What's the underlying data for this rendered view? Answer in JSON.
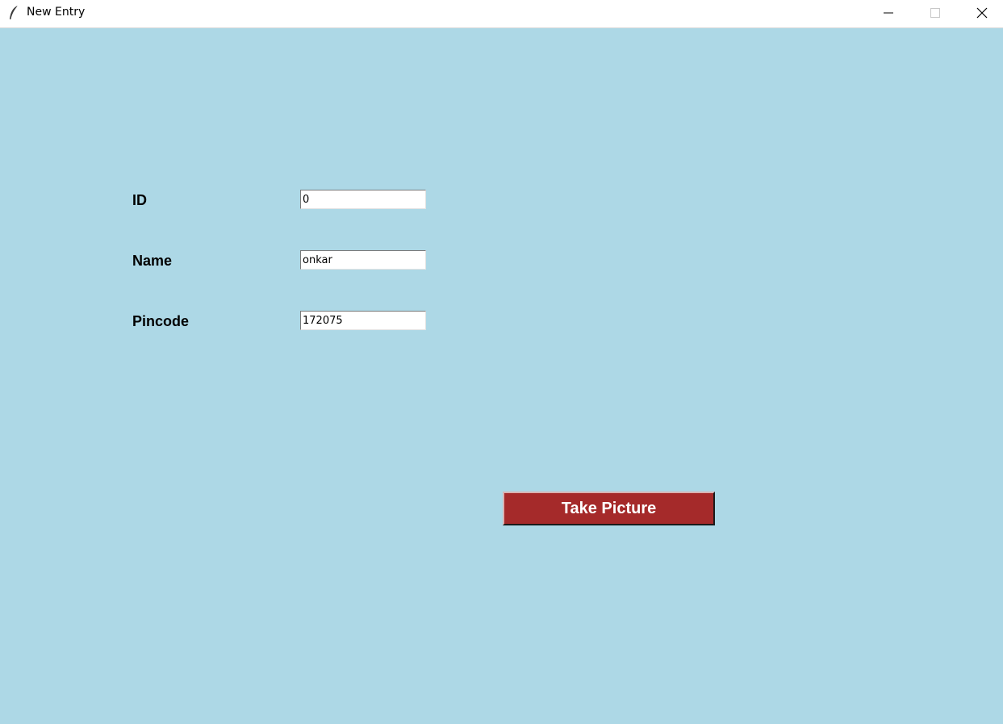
{
  "window": {
    "title": "New Entry",
    "icon": "feather-icon",
    "background": "#add8e6"
  },
  "form": {
    "id_label": "ID",
    "id_value": "0",
    "name_label": "Name",
    "name_value": "onkar",
    "pincode_label": "Pincode",
    "pincode_value": "172075"
  },
  "actions": {
    "take_picture_label": "Take Picture",
    "take_picture_color": "#a52a2a"
  }
}
